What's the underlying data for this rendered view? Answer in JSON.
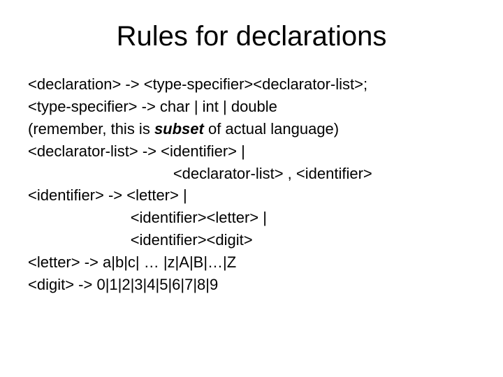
{
  "title": "Rules for declarations",
  "lines": {
    "l1": "<declaration> -> <type-specifier><declarator-list>;",
    "l2": "<type-specifier> -> char | int | double",
    "l3a": "(remember, this is ",
    "l3b": "subset",
    "l3c": " of actual language)",
    "l4": "<declarator-list> -> <identifier> |",
    "l5": "                                  <declarator-list> , <identifier>",
    "l6": "<identifier> -> <letter> |",
    "l7": "                        <identifier><letter> |",
    "l8": "                        <identifier><digit>",
    "l9": "<letter> -> a|b|c| … |z|A|B|…|Z",
    "l10": "<digit> -> 0|1|2|3|4|5|6|7|8|9"
  }
}
